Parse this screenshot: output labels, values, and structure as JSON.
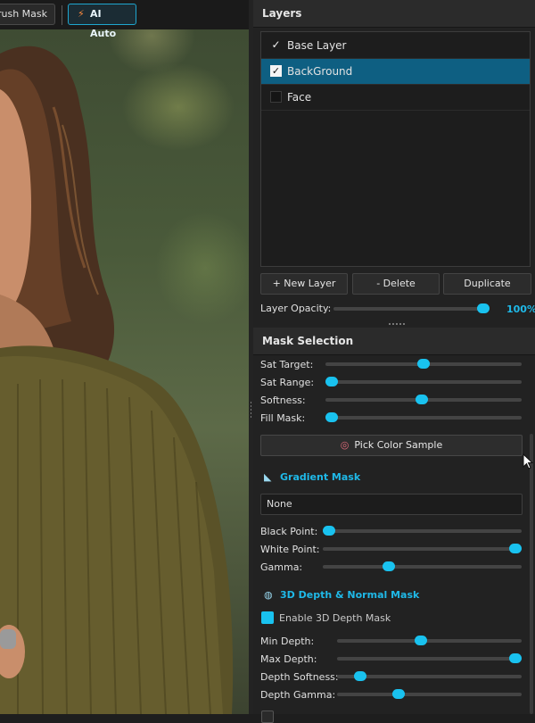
{
  "toolbar": {
    "brush_mask_label": "rush Mask",
    "ai_auto_label": "AI Auto",
    "ai_auto_icon": "lightning-icon"
  },
  "layers": {
    "header": "Layers",
    "items": [
      {
        "label": "Base Layer",
        "checked": true,
        "selected": false
      },
      {
        "label": "BackGround",
        "checked": true,
        "selected": true
      },
      {
        "label": "Face",
        "checked": false,
        "selected": false
      }
    ],
    "new_layer_label": "+ New Layer",
    "delete_label": "- Delete",
    "duplicate_label": "Duplicate",
    "opacity_label": "Layer Opacity:",
    "opacity_value": "100%",
    "opacity_fraction": 1.0
  },
  "mask_selection": {
    "header": "Mask  Selection",
    "sliders": [
      {
        "label": "Sat Target:",
        "fraction": 0.5
      },
      {
        "label": "Sat Range:",
        "fraction": 0.0
      },
      {
        "label": "Softness:",
        "fraction": 0.49
      },
      {
        "label": "Fill Mask:",
        "fraction": 0.0
      }
    ],
    "pick_color_label": "Pick Color Sample",
    "pick_color_icon": "target-icon"
  },
  "gradient_mask": {
    "title": "Gradient Mask",
    "icon": "gradient-icon",
    "selected_option": "None",
    "sliders": [
      {
        "label": "Black Point:",
        "fraction": 0.0
      },
      {
        "label": "White Point:",
        "fraction": 1.0
      },
      {
        "label": "Gamma:",
        "fraction": 0.32
      }
    ]
  },
  "depth_mask": {
    "title": "3D Depth & Normal Mask",
    "icon": "globe-icon",
    "enable_label": "Enable 3D Depth Mask",
    "enabled": true,
    "sliders": [
      {
        "label": "Min Depth:",
        "fraction": 0.45
      },
      {
        "label": "Max Depth:",
        "fraction": 1.0
      },
      {
        "label": "Depth Softness:",
        "fraction": 0.1
      },
      {
        "label": "Depth Gamma:",
        "fraction": 0.32
      }
    ]
  },
  "colors": {
    "accent": "#19c2ef",
    "selected_row": "#0e5f82",
    "panel_bg": "#222222"
  }
}
